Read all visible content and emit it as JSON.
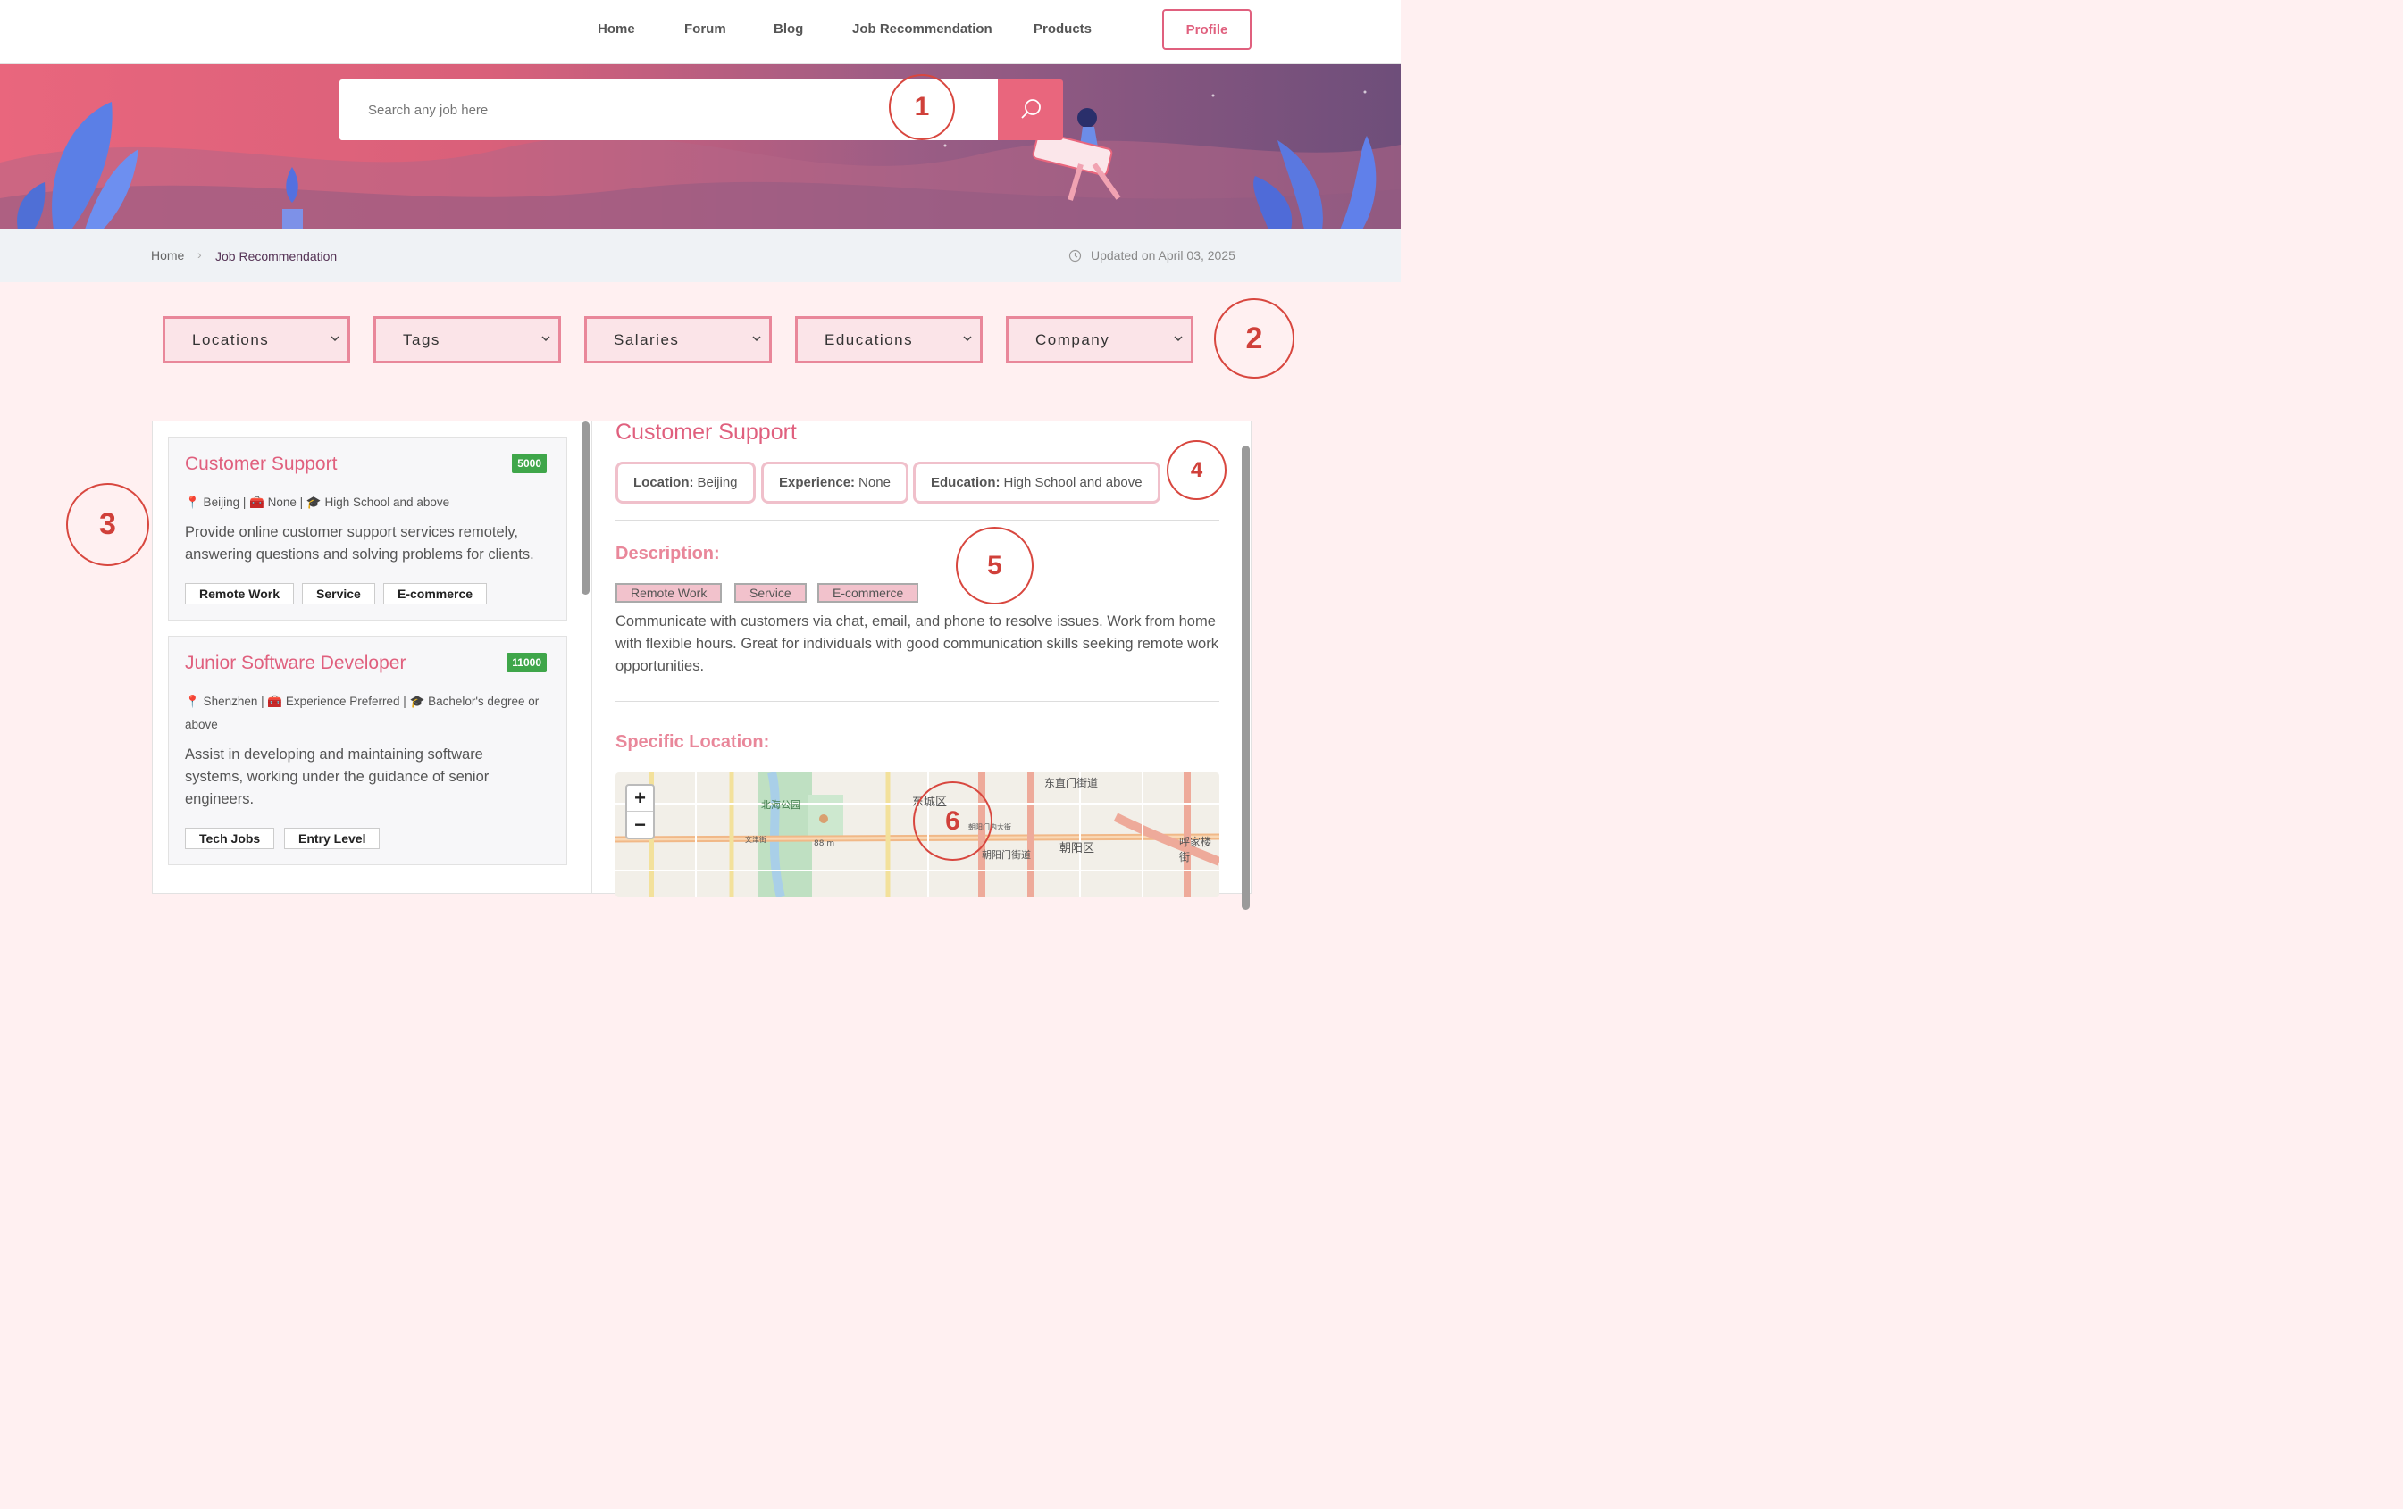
{
  "nav": {
    "items": [
      "Home",
      "Forum",
      "Blog",
      "Job Recommendation",
      "Products"
    ],
    "profile_label": "Profile"
  },
  "search": {
    "placeholder": "Search any job here",
    "icon": "search-icon"
  },
  "breadcrumb": {
    "home": "Home",
    "separator": "›",
    "current": "Job Recommendation",
    "updated": "Updated on April 03, 2025"
  },
  "filters": [
    "Locations",
    "Tags",
    "Salaries",
    "Educations",
    "Company"
  ],
  "callouts": [
    "1",
    "2",
    "3",
    "4",
    "5",
    "6"
  ],
  "jobs": [
    {
      "title": "Customer Support",
      "salary": "5000",
      "meta": "📍 Beijing | 🧰 None | 🎓 High School and above",
      "description": "Provide online customer support services remotely, answering questions and solving problems for clients.",
      "tags": [
        "Remote Work",
        "Service",
        "E-commerce"
      ]
    },
    {
      "title": "Junior Software Developer",
      "salary": "11000",
      "meta": "📍 Shenzhen | 🧰 Experience Preferred | 🎓 Bachelor's degree or above",
      "description": "Assist in developing and maintaining software systems, working under the guidance of senior engineers.",
      "tags": [
        "Tech Jobs",
        "Entry Level"
      ]
    }
  ],
  "detail": {
    "title": "Customer Support",
    "location_label": "Location:",
    "location": "Beijing",
    "experience_label": "Experience:",
    "experience": "None",
    "education_label": "Education:",
    "education": "High School and above",
    "description_heading": "Description:",
    "tags": [
      "Remote Work",
      "Service",
      "E-commerce"
    ],
    "description": "Communicate with customers via chat, email, and phone to resolve issues. Work from home with flexible hours. Great for individuals with good communication skills seeking remote work opportunities.",
    "location_heading": "Specific Location:"
  },
  "map": {
    "zoom_in": "+",
    "zoom_out": "−",
    "labels": [
      "北海公园",
      "东城区",
      "东直门街道",
      "朝阳门街道",
      "朝阳区",
      "呼家楼街",
      "88 m",
      "文津街",
      "朝阳门内大街"
    ]
  },
  "colors": {
    "accent": "#e0607e",
    "salary_badge": "#3fa64a",
    "callout": "#d8473f"
  }
}
